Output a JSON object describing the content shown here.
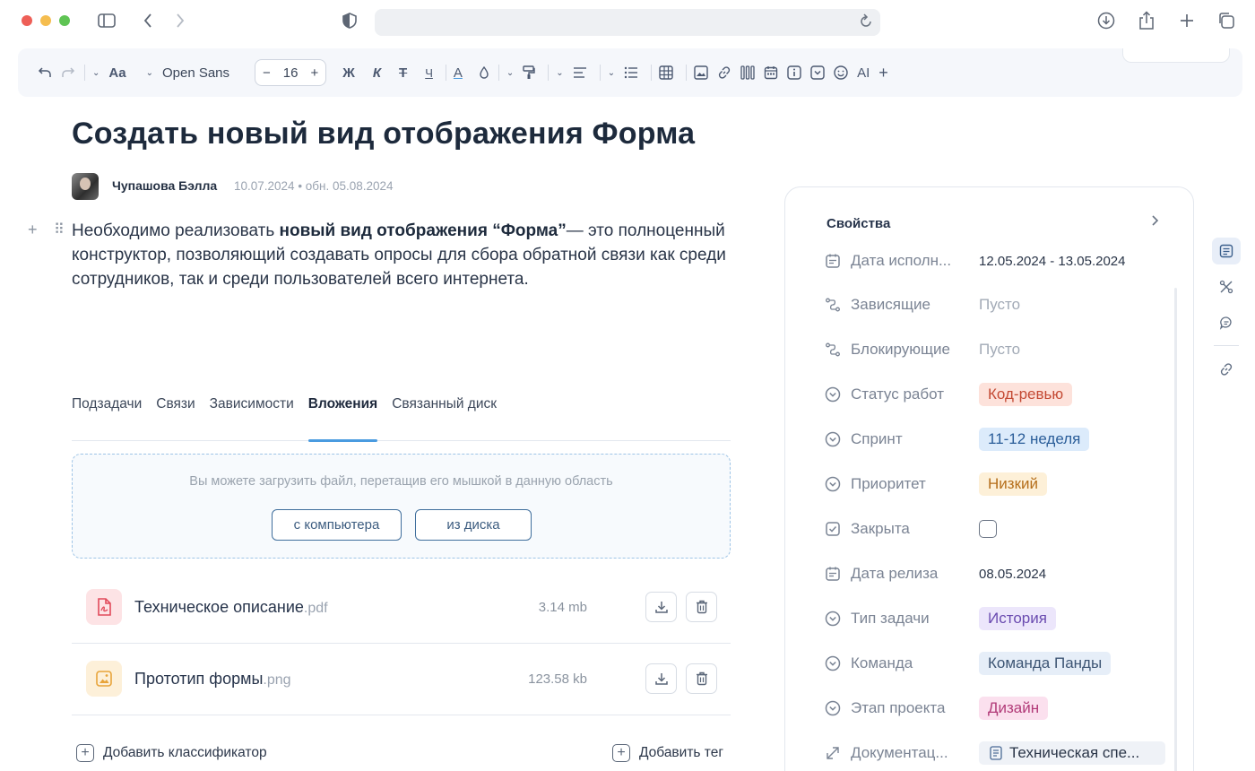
{
  "toolbar": {
    "font_name": "Open Sans",
    "font_size": "16",
    "bold": "Ж",
    "italic": "К",
    "strike": "Т",
    "underline": "Ч",
    "text_color": "A",
    "ai": "AI",
    "textsize_icon": "Aa"
  },
  "document": {
    "title": "Создать новый вид отображения Форма",
    "author": "Чупашова Бэлла",
    "dates": "10.07.2024 • обн. 05.08.2024",
    "para_lead": "Необходимо реализовать ",
    "para_bold": "новый вид отображения “Форма”",
    "para_rest": "— это полноценный конструктор, позволяющий создавать опросы для сбора обратной связи как среди сотрудников, так и среди пользователей всего интернета."
  },
  "tabs": [
    {
      "label": "Подзадачи"
    },
    {
      "label": "Связи"
    },
    {
      "label": "Зависимости"
    },
    {
      "label": "Вложения"
    },
    {
      "label": "Связанный диск"
    }
  ],
  "dropzone": {
    "text": "Вы можете загрузить файл, перетащив его мышкой в данную область",
    "from_computer": "с компьютера",
    "from_disk": "из диска"
  },
  "files": [
    {
      "name": "Техническое описание",
      "ext": ".pdf",
      "size": "3.14 mb"
    },
    {
      "name": "Прототип формы",
      "ext": ".png",
      "size": "123.58 kb"
    }
  ],
  "footer": {
    "add_classifier": "Добавить классификатор",
    "add_tag": "Добавить тег"
  },
  "properties": {
    "header": "Свойства",
    "items": [
      {
        "label": "Дата исполн...",
        "value": "12.05.2024 - 13.05.2024"
      },
      {
        "label": "Зависящие",
        "value": "Пусто"
      },
      {
        "label": "Блокирующие",
        "value": "Пусто"
      },
      {
        "label": "Статус работ",
        "value": "Код-ревью"
      },
      {
        "label": "Спринт",
        "value": "11-12 неделя"
      },
      {
        "label": "Приоритет",
        "value": "Низкий"
      },
      {
        "label": "Закрыта",
        "value": ""
      },
      {
        "label": "Дата релиза",
        "value": "08.05.2024"
      },
      {
        "label": "Тип задачи",
        "value": "История"
      },
      {
        "label": "Команда",
        "value": "Команда Панды"
      },
      {
        "label": "Этап проекта",
        "value": "Дизайн"
      },
      {
        "label": "Документац...",
        "value": "Техническая спе..."
      }
    ]
  },
  "colors": {
    "accent": "#4a9be0",
    "status": "#fde2db",
    "sprint": "#dcebfb",
    "priority": "#fdf0d8",
    "type": "#ece6fb",
    "team": "#e6eef8",
    "stage": "#fbe0ee"
  },
  "icons": [
    "sidebar-icon",
    "back-icon",
    "forward-icon",
    "shield-icon",
    "reload-icon",
    "download-icon",
    "share-icon",
    "new-tab-icon",
    "tabs-icon"
  ]
}
